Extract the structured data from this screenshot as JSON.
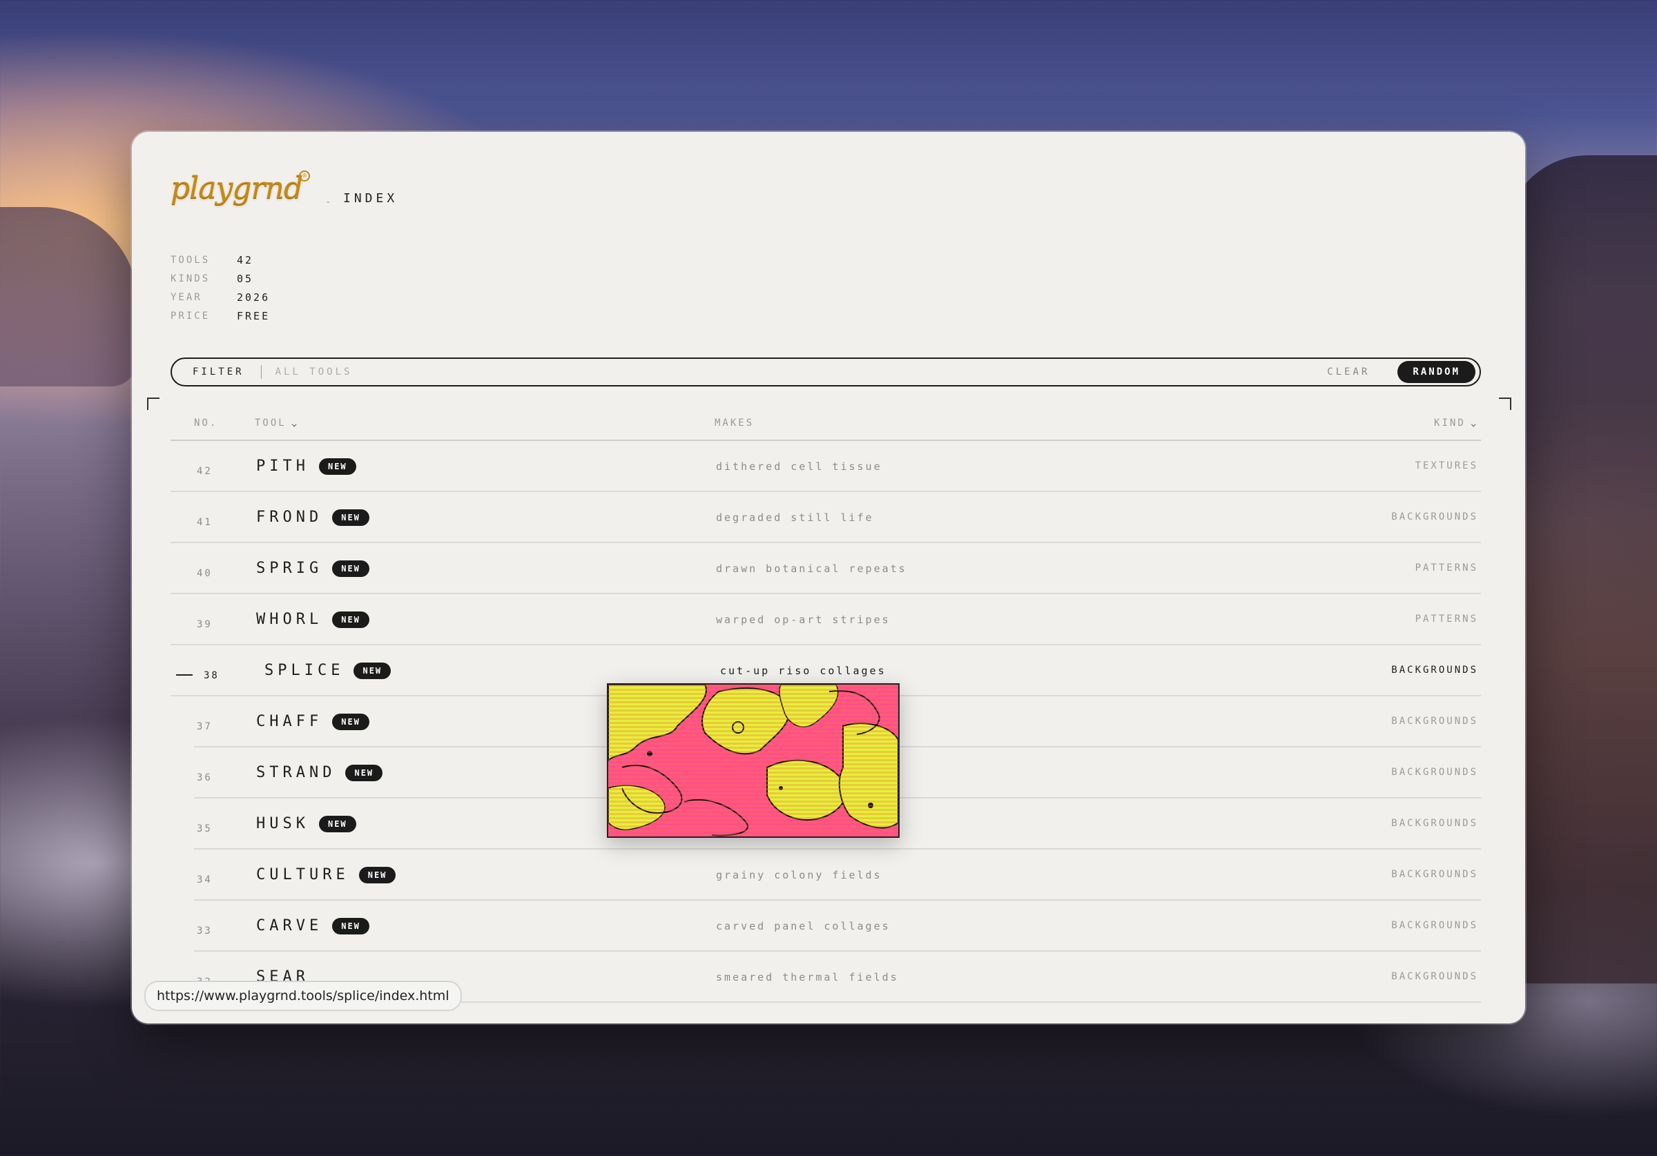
{
  "brand": {
    "logo": "playgrnd",
    "reg": "®",
    "dash": "-",
    "section": "INDEX"
  },
  "stats": [
    {
      "key": "TOOLS",
      "value": "42"
    },
    {
      "key": "KINDS",
      "value": "05"
    },
    {
      "key": "YEAR",
      "value": "2026"
    },
    {
      "key": "PRICE",
      "value": "FREE"
    }
  ],
  "filter": {
    "label": "FILTER",
    "placeholder": "ALL TOOLS",
    "clear": "CLEAR",
    "random": "RANDOM"
  },
  "table": {
    "headers": {
      "no": "NO.",
      "tool": "TOOL",
      "makes": "MAKES",
      "kind": "KIND"
    },
    "badge": "NEW",
    "rows": [
      {
        "no": "42",
        "tool": "PITH",
        "makes": "dithered cell tissue",
        "kind": "TEXTURES",
        "new": true
      },
      {
        "no": "41",
        "tool": "FROND",
        "makes": "degraded still life",
        "kind": "BACKGROUNDS",
        "new": true
      },
      {
        "no": "40",
        "tool": "SPRIG",
        "makes": "drawn botanical repeats",
        "kind": "PATTERNS",
        "new": true
      },
      {
        "no": "39",
        "tool": "WHORL",
        "makes": "warped op-art stripes",
        "kind": "PATTERNS",
        "new": true
      },
      {
        "no": "38",
        "tool": "SPLICE",
        "makes": "cut-up riso collages",
        "kind": "BACKGROUNDS",
        "new": true,
        "active": true
      },
      {
        "no": "37",
        "tool": "CHAFF",
        "makes": "",
        "kind": "BACKGROUNDS",
        "new": true
      },
      {
        "no": "36",
        "tool": "STRAND",
        "makes": "",
        "kind": "BACKGROUNDS",
        "new": true
      },
      {
        "no": "35",
        "tool": "HUSK",
        "makes": "",
        "kind": "BACKGROUNDS",
        "new": true
      },
      {
        "no": "34",
        "tool": "CULTURE",
        "makes": "grainy colony fields",
        "kind": "BACKGROUNDS",
        "new": true
      },
      {
        "no": "33",
        "tool": "CARVE",
        "makes": "carved panel collages",
        "kind": "BACKGROUNDS",
        "new": true
      },
      {
        "no": "32",
        "tool": "SEAR",
        "makes": "smeared thermal fields",
        "kind": "BACKGROUNDS",
        "new": false
      }
    ]
  },
  "status_url": "https://www.playgrnd.tools/splice/index.html",
  "colors": {
    "accent_gold": "#c48a14",
    "preview_pink": "#ff4f8d",
    "preview_yellow": "#e2f23a"
  }
}
